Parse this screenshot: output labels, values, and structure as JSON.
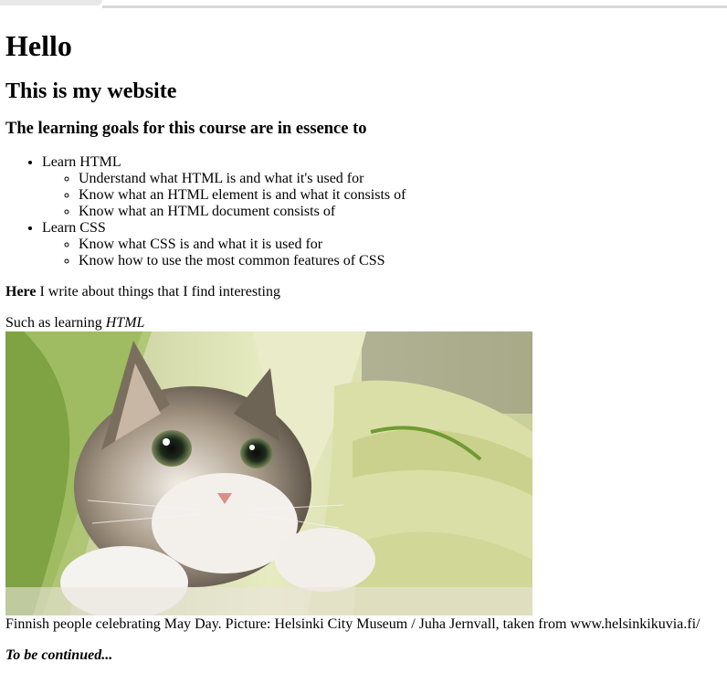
{
  "heading": {
    "h1": "Hello",
    "h2": "This is my website",
    "h3": "The learning goals for this course are in essence to"
  },
  "goals": {
    "items": [
      {
        "label": "Learn HTML",
        "sub": [
          "Understand what HTML is and what it's used for",
          "Know what an HTML element is and what it consists of",
          "Know what an HTML document consists of"
        ]
      },
      {
        "label": "Learn CSS",
        "sub": [
          "Know what CSS is and what it is used for",
          "Know how to use the most common features of CSS"
        ]
      }
    ]
  },
  "intro": {
    "bold": "Here",
    "rest": " I write about things that I find interesting"
  },
  "such_as": {
    "prefix": "Such as learning ",
    "emphasis": "HTML"
  },
  "image": {
    "alt": "cat-photo"
  },
  "caption": "Finnish people celebrating May Day. Picture: Helsinki City Museum / Juha Jernvall, taken from www.helsinkikuvia.fi/",
  "footer": "To be continued..."
}
